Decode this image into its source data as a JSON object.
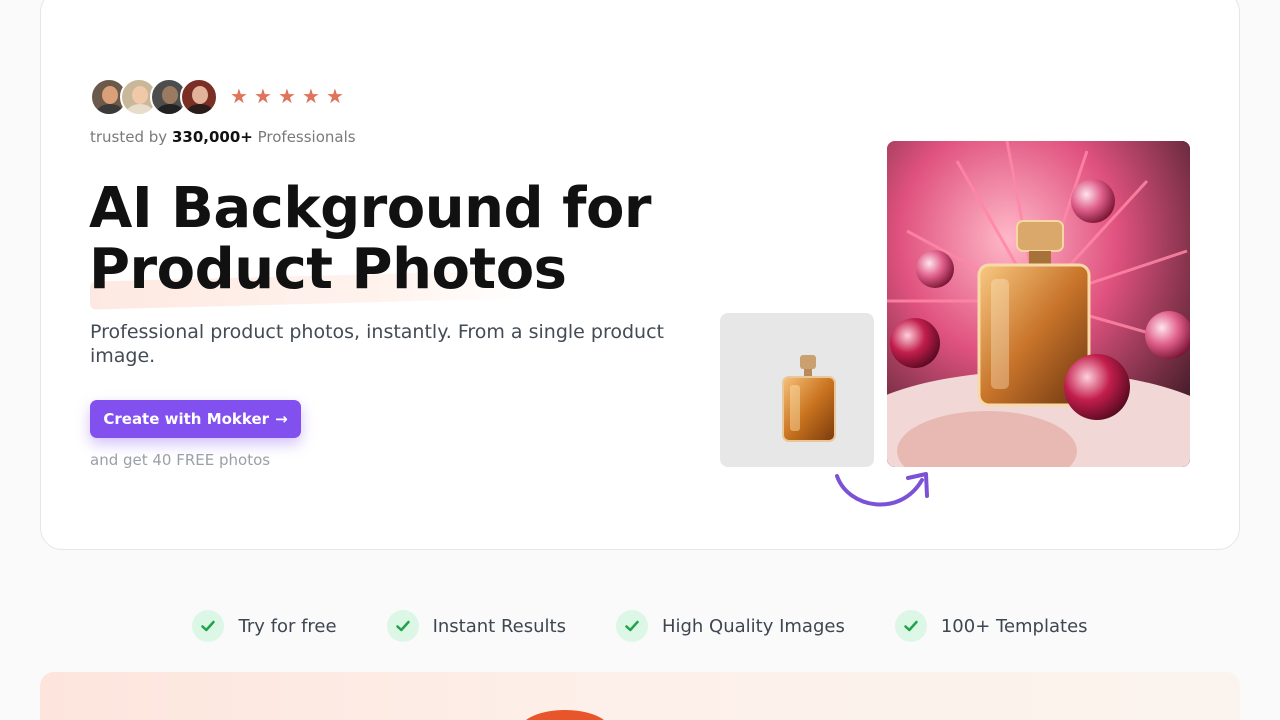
{
  "social_proof": {
    "trusted_prefix": "trusted by",
    "trusted_count": "330,000+",
    "trusted_suffix": "Professionals",
    "rating_stars": 5,
    "star_glyph": "★"
  },
  "hero": {
    "headline_line1": "AI Background for",
    "headline_line2": "Product Photos",
    "subtitle": "Professional product photos, instantly. From a single product image.",
    "cta_label": "Create with Mokker",
    "cta_arrow": "→",
    "cta_note": "and get 40 FREE photos"
  },
  "features": [
    {
      "label": "Try for free"
    },
    {
      "label": "Instant Results"
    },
    {
      "label": "High Quality Images"
    },
    {
      "label": "100+ Templates"
    }
  ],
  "colors": {
    "accent": "#8250ee",
    "star": "#e0745a",
    "check_bg": "#dcf7e6",
    "check": "#22a34a"
  }
}
